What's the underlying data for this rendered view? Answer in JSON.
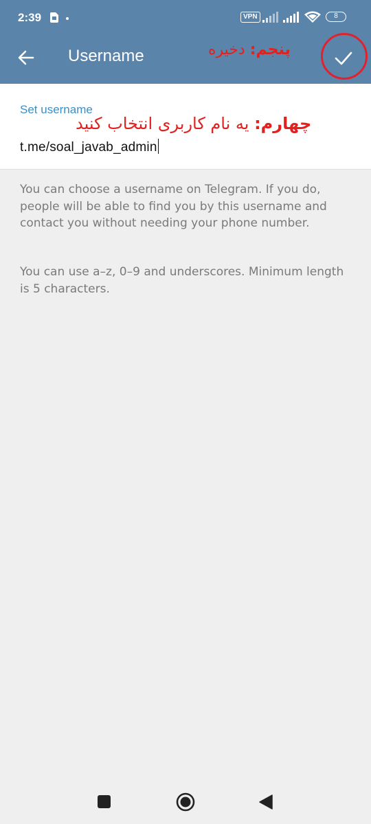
{
  "status_bar": {
    "time": "2:39",
    "vpn": "VPN",
    "battery": "8"
  },
  "toolbar": {
    "title": "Username"
  },
  "annotations": {
    "step5_bold": "پنجم:",
    "step5_text": " دخیره",
    "step4_bold": "چهارم:",
    "step4_text": " یه نام کاربری انتخاب کنید"
  },
  "field": {
    "label": "Set username",
    "value": "t.me/soal_javab_admin"
  },
  "help": {
    "paragraph1": "You can choose a username on Telegram. If you do, people will be able to find you by this username and contact you without needing your phone number.",
    "paragraph2": "You can use a–z, 0–9 and underscores. Minimum length is 5 characters."
  },
  "colors": {
    "header": "#5b84ab",
    "accent": "#3b8fc6",
    "annotation": "#e2211e",
    "background": "#efefef"
  },
  "icons": [
    "sim-icon",
    "vpn-icon",
    "signal-icon",
    "wifi-icon",
    "battery-icon",
    "back-arrow-icon",
    "check-icon",
    "nav-square-icon",
    "nav-home-icon",
    "nav-back-icon"
  ]
}
